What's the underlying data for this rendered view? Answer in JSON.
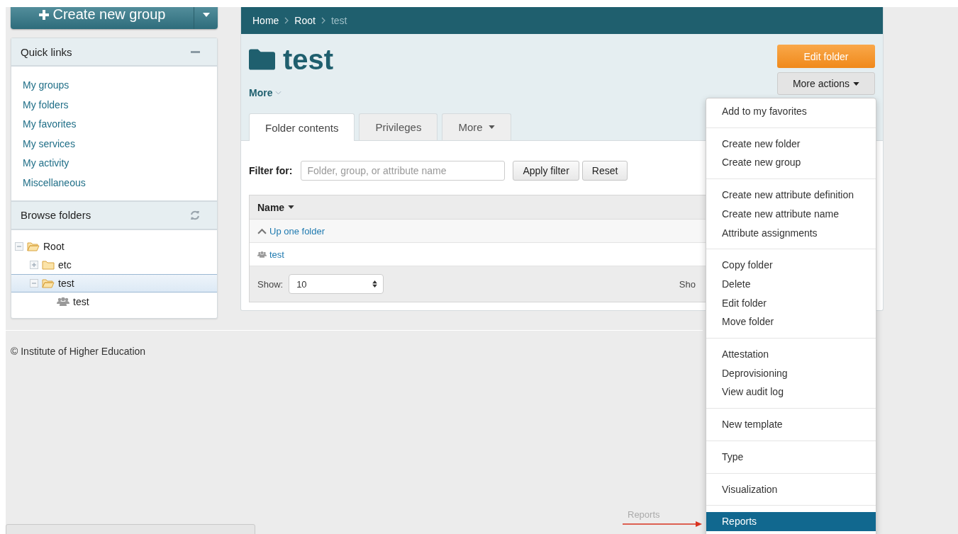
{
  "create_button": {
    "label": "Create new group"
  },
  "quick_links": {
    "title": "Quick links",
    "items": [
      "My groups",
      "My folders",
      "My favorites",
      "My services",
      "My activity",
      "Miscellaneous"
    ]
  },
  "browse_folders": {
    "title": "Browse folders",
    "tree": [
      {
        "label": "Root",
        "kind": "folder",
        "expanded": true,
        "selected": false,
        "children": [
          {
            "label": "etc",
            "kind": "folder",
            "expanded": false,
            "selected": false
          },
          {
            "label": "test",
            "kind": "folder",
            "expanded": true,
            "selected": true,
            "children": [
              {
                "label": "test",
                "kind": "group",
                "selected": false
              }
            ]
          }
        ]
      }
    ]
  },
  "footer": "© Institute of Higher Education",
  "breadcrumb": [
    {
      "label": "Home",
      "current": false
    },
    {
      "label": "Root",
      "current": false
    },
    {
      "label": "test",
      "current": true
    }
  ],
  "folder": {
    "title": "test",
    "more_link": "More"
  },
  "actions": {
    "primary": "Edit folder",
    "dropdown": "More actions"
  },
  "tabs": [
    {
      "label": "Folder contents",
      "selected": true,
      "kind": "plain"
    },
    {
      "label": "Privileges",
      "selected": false,
      "kind": "plain"
    },
    {
      "label": "More",
      "selected": false,
      "kind": "dropdown"
    }
  ],
  "filter": {
    "label": "Filter for:",
    "placeholder": "Folder, group, or attribute name",
    "buttons": [
      "Apply filter",
      "Reset"
    ]
  },
  "table": {
    "column": "Name",
    "rows": [
      {
        "kind": "up",
        "label": "Up one folder"
      },
      {
        "kind": "group",
        "label": "test"
      }
    ],
    "show_label": "Show:",
    "show_value": "10",
    "cut_text": "Sho"
  },
  "menu": [
    [
      {
        "label": "Add to my favorites",
        "selected": false
      }
    ],
    [
      {
        "label": "Create new folder",
        "selected": false
      },
      {
        "label": "Create new group",
        "selected": false
      }
    ],
    [
      {
        "label": "Create new attribute definition",
        "selected": false
      },
      {
        "label": "Create new attribute name",
        "selected": false
      },
      {
        "label": "Attribute assignments",
        "selected": false
      }
    ],
    [
      {
        "label": "Copy folder",
        "selected": false
      },
      {
        "label": "Delete",
        "selected": false
      },
      {
        "label": "Edit folder",
        "selected": false
      },
      {
        "label": "Move folder",
        "selected": false
      }
    ],
    [
      {
        "label": "Attestation",
        "selected": false
      },
      {
        "label": "Deprovisioning",
        "selected": false
      },
      {
        "label": "View audit log",
        "selected": false
      }
    ],
    [
      {
        "label": "New template",
        "selected": false
      }
    ],
    [
      {
        "label": "Type",
        "selected": false
      }
    ],
    [
      {
        "label": "Visualization",
        "selected": false
      }
    ],
    [
      {
        "label": "Reports",
        "selected": true
      }
    ]
  ],
  "annotation": {
    "label": "Reports"
  }
}
